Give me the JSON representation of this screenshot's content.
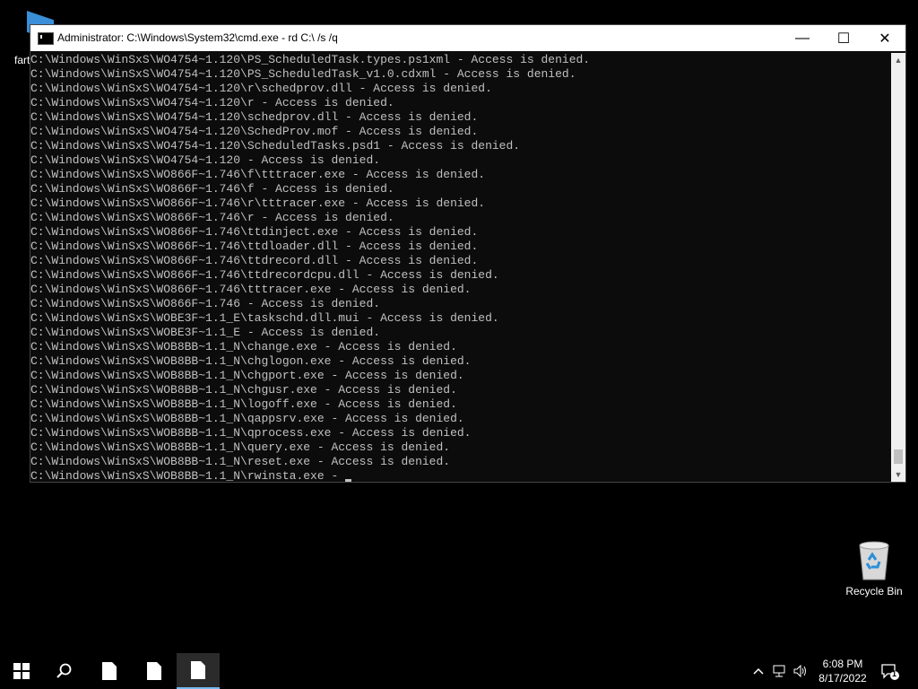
{
  "desktop": {
    "top_icon_label": "fart",
    "recycle_label": "Recycle Bin"
  },
  "window": {
    "title": "Administrator: C:\\Windows\\System32\\cmd.exe - rd  C:\\ /s /q",
    "minimize_glyph": "—",
    "maximize_glyph": "☐",
    "close_glyph": "✕"
  },
  "console_lines": [
    "C:\\Windows\\WinSxS\\WO4754~1.120\\PS_ScheduledTask.types.ps1xml - Access is denied.",
    "C:\\Windows\\WinSxS\\WO4754~1.120\\PS_ScheduledTask_v1.0.cdxml - Access is denied.",
    "C:\\Windows\\WinSxS\\WO4754~1.120\\r\\schedprov.dll - Access is denied.",
    "C:\\Windows\\WinSxS\\WO4754~1.120\\r - Access is denied.",
    "C:\\Windows\\WinSxS\\WO4754~1.120\\schedprov.dll - Access is denied.",
    "C:\\Windows\\WinSxS\\WO4754~1.120\\SchedProv.mof - Access is denied.",
    "C:\\Windows\\WinSxS\\WO4754~1.120\\ScheduledTasks.psd1 - Access is denied.",
    "C:\\Windows\\WinSxS\\WO4754~1.120 - Access is denied.",
    "C:\\Windows\\WinSxS\\WO866F~1.746\\f\\tttracer.exe - Access is denied.",
    "C:\\Windows\\WinSxS\\WO866F~1.746\\f - Access is denied.",
    "C:\\Windows\\WinSxS\\WO866F~1.746\\r\\tttracer.exe - Access is denied.",
    "C:\\Windows\\WinSxS\\WO866F~1.746\\r - Access is denied.",
    "C:\\Windows\\WinSxS\\WO866F~1.746\\ttdinject.exe - Access is denied.",
    "C:\\Windows\\WinSxS\\WO866F~1.746\\ttdloader.dll - Access is denied.",
    "C:\\Windows\\WinSxS\\WO866F~1.746\\ttdrecord.dll - Access is denied.",
    "C:\\Windows\\WinSxS\\WO866F~1.746\\ttdrecordcpu.dll - Access is denied.",
    "C:\\Windows\\WinSxS\\WO866F~1.746\\tttracer.exe - Access is denied.",
    "C:\\Windows\\WinSxS\\WO866F~1.746 - Access is denied.",
    "C:\\Windows\\WinSxS\\WOBE3F~1.1_E\\taskschd.dll.mui - Access is denied.",
    "C:\\Windows\\WinSxS\\WOBE3F~1.1_E - Access is denied.",
    "C:\\Windows\\WinSxS\\WOB8BB~1.1_N\\change.exe - Access is denied.",
    "C:\\Windows\\WinSxS\\WOB8BB~1.1_N\\chglogon.exe - Access is denied.",
    "C:\\Windows\\WinSxS\\WOB8BB~1.1_N\\chgport.exe - Access is denied.",
    "C:\\Windows\\WinSxS\\WOB8BB~1.1_N\\chgusr.exe - Access is denied.",
    "C:\\Windows\\WinSxS\\WOB8BB~1.1_N\\logoff.exe - Access is denied.",
    "C:\\Windows\\WinSxS\\WOB8BB~1.1_N\\qappsrv.exe - Access is denied.",
    "C:\\Windows\\WinSxS\\WOB8BB~1.1_N\\qprocess.exe - Access is denied.",
    "C:\\Windows\\WinSxS\\WOB8BB~1.1_N\\query.exe - Access is denied.",
    "C:\\Windows\\WinSxS\\WOB8BB~1.1_N\\reset.exe - Access is denied.",
    "C:\\Windows\\WinSxS\\WOB8BB~1.1_N\\rwinsta.exe - "
  ],
  "taskbar": {
    "time": "6:08 PM",
    "date": "8/17/2022",
    "notification_count": "1"
  },
  "colors": {
    "console_text": "#c0c0c0",
    "console_bg": "#0c0c0c",
    "active_task_accent": "#76b9ed"
  }
}
